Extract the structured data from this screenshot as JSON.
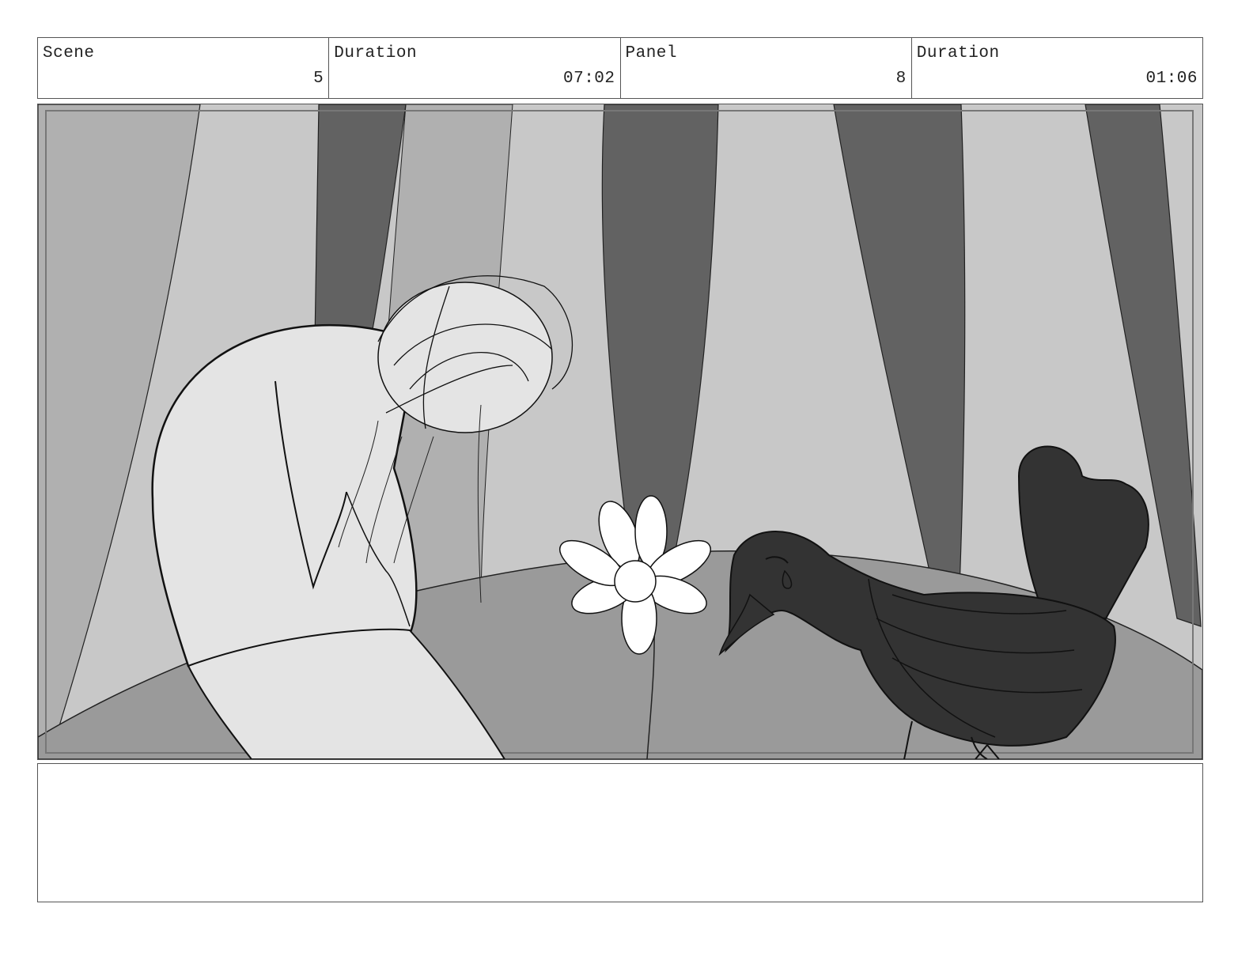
{
  "header": {
    "scene": {
      "label": "Scene",
      "value": "5"
    },
    "scene_duration": {
      "label": "Duration",
      "value": "07:02"
    },
    "panel": {
      "label": "Panel",
      "value": "8"
    },
    "panel_duration": {
      "label": "Duration",
      "value": "01:06"
    }
  },
  "notes": {
    "text": ""
  },
  "colors": {
    "border": "#555555",
    "curtain_light": "#c8c8c8",
    "curtain_mid": "#b0b0b0",
    "curtain_dark": "#626262",
    "floor": "#9a9a9a",
    "figure": "#e4e4e4",
    "bird": "#333333",
    "flower": "#ffffff"
  }
}
